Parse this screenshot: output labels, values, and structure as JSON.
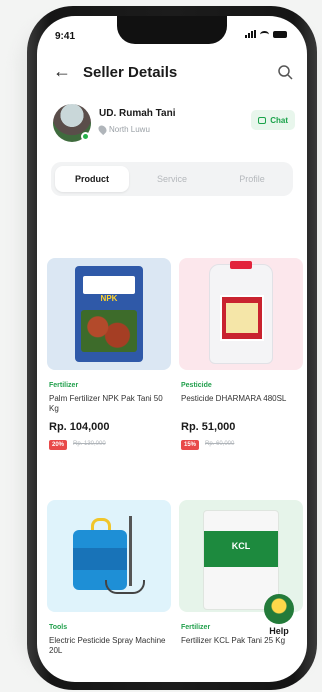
{
  "status_bar": {
    "time": "9:41"
  },
  "header": {
    "title": "Seller Details"
  },
  "seller": {
    "name": "UD. Rumah Tani",
    "location": "North Luwu",
    "chat_label": "Chat"
  },
  "tabs": [
    {
      "label": "Product",
      "active": true
    },
    {
      "label": "Service",
      "active": false
    },
    {
      "label": "Profile",
      "active": false
    }
  ],
  "products": [
    {
      "category": "Fertilizer",
      "name": "Palm Fertilizer NPK Pak Tani 50 Kg",
      "price": "Rp. 104,000",
      "discount": "20%",
      "old_price": "Rp. 130,000",
      "bag_label": "NPK"
    },
    {
      "category": "Pesticide",
      "name": "Pesticide DHARMARA 480SL",
      "price": "Rp. 51,000",
      "discount": "15%",
      "old_price": "Rp. 60,000"
    },
    {
      "category": "Tools",
      "name": "Electric Pesticide Spray Machine 20L"
    },
    {
      "category": "Fertilizer",
      "name": "Fertilizer KCL Pak Tani 25 Kg",
      "bag_label": "KCL"
    }
  ],
  "help_label": "Help",
  "colors": {
    "accent_green": "#22a04d",
    "discount_red": "#e84a4a"
  }
}
